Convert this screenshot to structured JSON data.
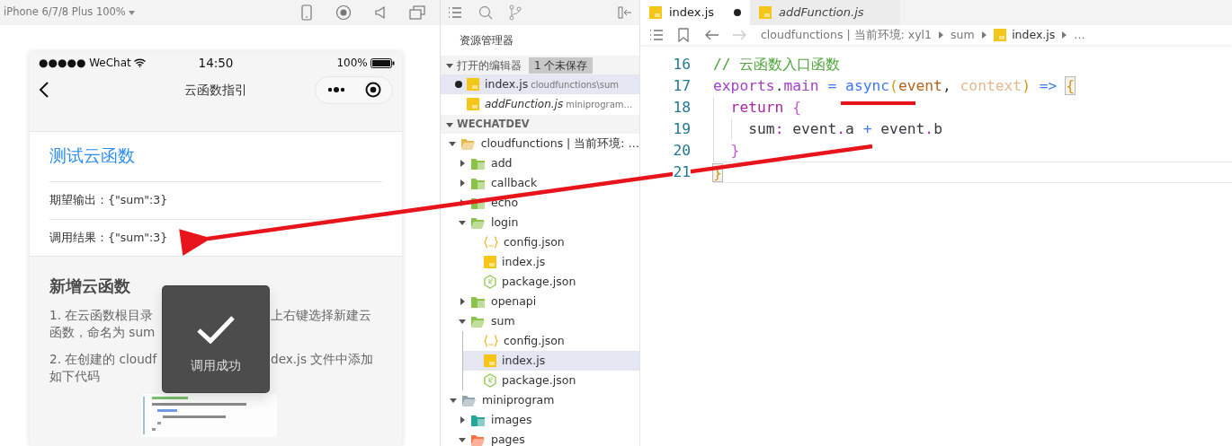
{
  "simulator": {
    "device": "iPhone 6/7/8 Plus 100%"
  },
  "phone": {
    "carrier": "●●●●● WeChat",
    "time": "14:50",
    "battery": "100%",
    "nav_title": "云函数指引",
    "test_card": {
      "title": "测试云函数",
      "rows": [
        "期望输出：{\"sum\":3}",
        "调用结果：{\"sum\":3}"
      ]
    },
    "guide": {
      "title": "新增云函数",
      "paragraphs": [
        {
          "lines": [
            {
              "left": "1. 在云函数根目录",
              "right": "上右键选择新建云"
            },
            {
              "left": "函数，命名为 sum"
            }
          ]
        },
        {
          "lines": [
            {
              "left": "2. 在创建的 cloudf",
              "right": "dex.js 文件中添加"
            },
            {
              "left": "如下代码"
            }
          ]
        }
      ]
    },
    "toast": {
      "text": "调用成功"
    }
  },
  "explorer": {
    "title": "资源管理器",
    "open_editors": {
      "label": "打开的编辑器",
      "badge": "1 个未保存",
      "expanded": true,
      "items": [
        {
          "name": "index.js",
          "path": "cloudfunctions\\sum",
          "modified": true,
          "preview": false,
          "selected": true
        },
        {
          "name": "addFunction.js",
          "path": "miniprogram…",
          "modified": false,
          "preview": true,
          "selected": false
        }
      ]
    },
    "workspace": {
      "label": "WECHATDEV",
      "expanded": true,
      "tree": [
        {
          "name": "cloudfunctions | 当前环境: …",
          "kind": "folder",
          "color": "#e8b84a",
          "expanded": true,
          "selected": false,
          "children": [
            {
              "name": "add",
              "kind": "folder",
              "color": "#8bc34a",
              "expanded": false,
              "selected": false
            },
            {
              "name": "callback",
              "kind": "folder",
              "color": "#8bc34a",
              "expanded": false,
              "selected": false
            },
            {
              "name": "echo",
              "kind": "folder",
              "color": "#8bc34a",
              "expanded": false,
              "selected": false
            },
            {
              "name": "login",
              "kind": "folder",
              "color": "#8bc34a",
              "expanded": true,
              "selected": false,
              "children": [
                {
                  "name": "config.json",
                  "kind": "json",
                  "selected": false
                },
                {
                  "name": "index.js",
                  "kind": "js",
                  "selected": false
                },
                {
                  "name": "package.json",
                  "kind": "package",
                  "selected": false
                }
              ]
            },
            {
              "name": "openapi",
              "kind": "folder",
              "color": "#8bc34a",
              "expanded": false,
              "selected": false
            },
            {
              "name": "sum",
              "kind": "folder",
              "color": "#8bc34a",
              "expanded": true,
              "selected": false,
              "children": [
                {
                  "name": "config.json",
                  "kind": "json",
                  "selected": false
                },
                {
                  "name": "index.js",
                  "kind": "js",
                  "selected": true
                },
                {
                  "name": "package.json",
                  "kind": "package",
                  "selected": false
                }
              ]
            }
          ]
        },
        {
          "name": "miniprogram",
          "kind": "folder",
          "color": "#90a4ae",
          "expanded": true,
          "selected": false,
          "children": [
            {
              "name": "images",
              "kind": "folder",
              "color": "#26a69a",
              "expanded": false,
              "selected": false
            },
            {
              "name": "pages",
              "kind": "folder",
              "color": "#ff7043",
              "expanded": true,
              "selected": false
            }
          ]
        }
      ]
    }
  },
  "editor": {
    "tabs": [
      {
        "name": "index.js",
        "modified": true,
        "preview": false,
        "selected": true
      },
      {
        "name": "addFunction.js",
        "modified": false,
        "preview": true,
        "selected": false
      }
    ],
    "breadcrumb": [
      {
        "text": "cloudfunctions | 当前环境: xyl1",
        "kind": "folder"
      },
      {
        "text": "sum",
        "kind": "folder"
      },
      {
        "text": "index.js",
        "kind": "file"
      },
      {
        "text": "…",
        "kind": "more"
      }
    ],
    "lines": [
      {
        "number": "16",
        "current": false,
        "tokens": [
          {
            "text": "// 云函数入口函数",
            "kind": "comment"
          }
        ]
      },
      {
        "number": "17",
        "current": false,
        "tokens": [
          {
            "text": "exports",
            "kind": "variable"
          },
          {
            "text": ".",
            "kind": "plain"
          },
          {
            "text": "main",
            "kind": "variable"
          },
          {
            "text": " = ",
            "kind": "operator"
          },
          {
            "text": "async",
            "kind": "function"
          },
          {
            "text": "(",
            "kind": "paren"
          },
          {
            "text": "event",
            "kind": "param"
          },
          {
            "text": ", ",
            "kind": "plain"
          },
          {
            "text": "context",
            "kind": "unused"
          },
          {
            "text": ")",
            "kind": "paren"
          },
          {
            "text": " => ",
            "kind": "operator"
          },
          {
            "text": "{",
            "kind": "paren",
            "match": true
          }
        ]
      },
      {
        "number": "18",
        "current": false,
        "tokens": [
          {
            "text": "  return",
            "kind": "keyword"
          },
          {
            "text": " {",
            "kind": "brace"
          }
        ]
      },
      {
        "number": "19",
        "current": false,
        "tokens": [
          {
            "text": "    sum",
            "kind": "plain"
          },
          {
            "text": ":",
            "kind": "keyword"
          },
          {
            "text": " event",
            "kind": "plain"
          },
          {
            "text": ".",
            "kind": "keyword"
          },
          {
            "text": "a",
            "kind": "plain"
          },
          {
            "text": " + ",
            "kind": "operator"
          },
          {
            "text": "event",
            "kind": "plain"
          },
          {
            "text": ".",
            "kind": "keyword"
          },
          {
            "text": "b",
            "kind": "plain"
          }
        ]
      },
      {
        "number": "20",
        "current": false,
        "tokens": [
          {
            "text": "  }",
            "kind": "brace"
          }
        ]
      },
      {
        "number": "21",
        "current": true,
        "tokens": [
          {
            "text": "}",
            "kind": "paren",
            "match": true
          }
        ]
      }
    ]
  }
}
